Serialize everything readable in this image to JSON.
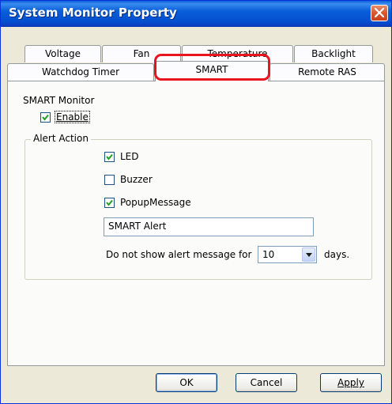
{
  "window": {
    "title": "System Monitor Property"
  },
  "tabs": {
    "row1": [
      "Voltage",
      "Fan",
      "Temperature",
      "Backlight"
    ],
    "row2": [
      "Watchdog Timer",
      "SMART",
      "Remote RAS"
    ],
    "active": "SMART"
  },
  "smart_monitor": {
    "heading": "SMART Monitor",
    "enable": {
      "label": "Enable",
      "checked": true
    }
  },
  "alert_action": {
    "title": "Alert Action",
    "led": {
      "label": "LED",
      "checked": true
    },
    "buzzer": {
      "label": "Buzzer",
      "checked": false
    },
    "popup": {
      "label": "PopupMessage",
      "checked": true
    },
    "message_value": "SMART Alert",
    "suppress_label": "Do not show alert message for",
    "days_value": "10",
    "days_suffix": "days."
  },
  "buttons": {
    "ok": "OK",
    "cancel": "Cancel",
    "apply": "Apply"
  },
  "colors": {
    "titlebar": "#0a5fd8",
    "highlight": "#e8141e",
    "face": "#ece9d8"
  },
  "icons": {
    "close": "close-icon",
    "check": "check-icon",
    "dropdown": "chevron-down-icon"
  }
}
